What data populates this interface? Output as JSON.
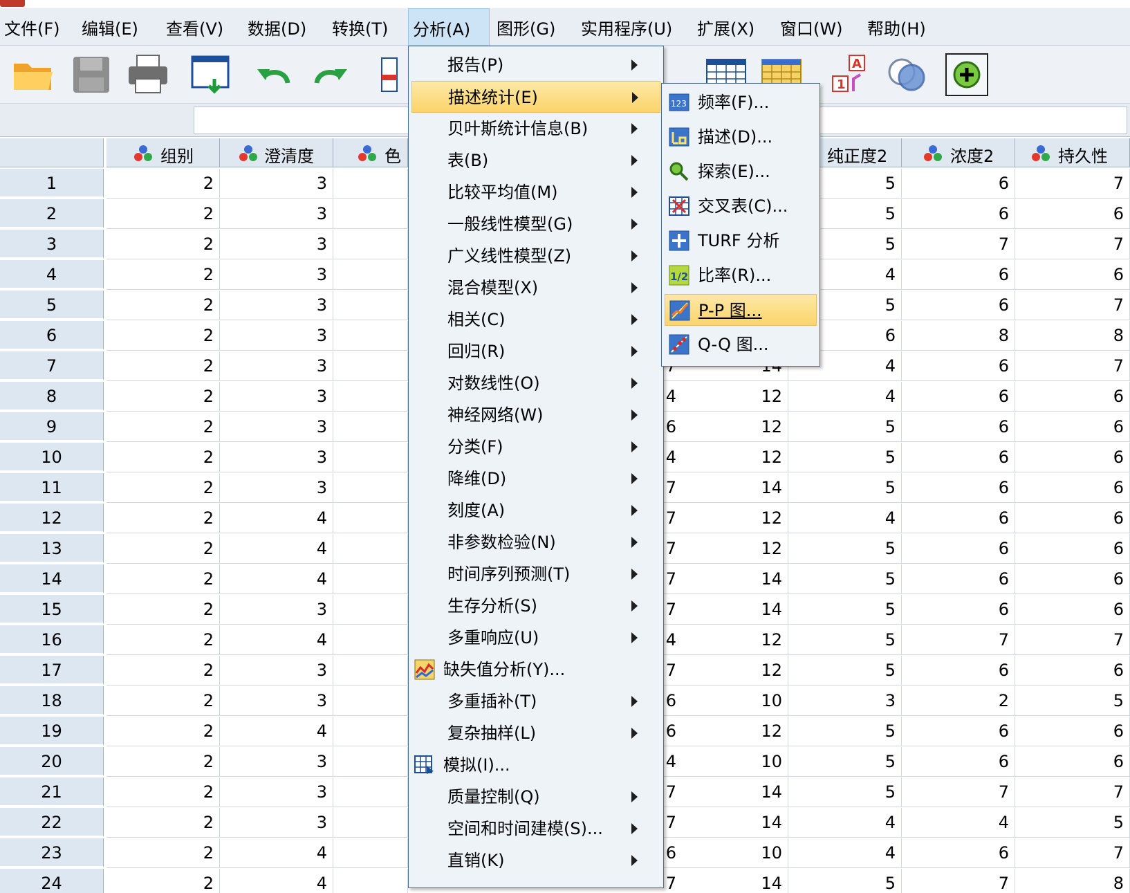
{
  "menubar": {
    "items": [
      {
        "label": "文件(F)"
      },
      {
        "label": "编辑(E)"
      },
      {
        "label": "查看(V)"
      },
      {
        "label": "数据(D)"
      },
      {
        "label": "转换(T)"
      },
      {
        "label": "分析(A)"
      },
      {
        "label": "图形(G)"
      },
      {
        "label": "实用程序(U)"
      },
      {
        "label": "扩展(X)"
      },
      {
        "label": "窗口(W)"
      },
      {
        "label": "帮助(H)"
      }
    ],
    "active_index": 5
  },
  "toolbar": {
    "buttons": [
      "open-folder-icon",
      "save-disk-icon",
      "printer-icon",
      "recall-dialog-icon",
      "undo-icon",
      "redo-icon",
      "goto-case-icon",
      "goto-variable-icon",
      "variables-grid-icon",
      "value-labels-icon",
      "split-file-icon",
      "weight-cases-icon",
      "add-on-icon"
    ]
  },
  "grid": {
    "headers": [
      "组别",
      "澄清度",
      "色",
      "纯正度2",
      "浓度2",
      "持久性"
    ],
    "rows": [
      {
        "n": "1",
        "c1": "2",
        "c2": "3",
        "c5": "",
        "c6": "",
        "c7": "5",
        "c8": "6",
        "c9": "7"
      },
      {
        "n": "2",
        "c1": "2",
        "c2": "3",
        "c5": "",
        "c6": "",
        "c7": "5",
        "c8": "6",
        "c9": "6"
      },
      {
        "n": "3",
        "c1": "2",
        "c2": "3",
        "c5": "",
        "c6": "",
        "c7": "5",
        "c8": "7",
        "c9": "7"
      },
      {
        "n": "4",
        "c1": "2",
        "c2": "3",
        "c5": "",
        "c6": "",
        "c7": "4",
        "c8": "6",
        "c9": "6"
      },
      {
        "n": "5",
        "c1": "2",
        "c2": "3",
        "c5": "",
        "c6": "",
        "c7": "5",
        "c8": "6",
        "c9": "7"
      },
      {
        "n": "6",
        "c1": "2",
        "c2": "3",
        "c5": "",
        "c6": "",
        "c7": "6",
        "c8": "8",
        "c9": "8"
      },
      {
        "n": "7",
        "c1": "2",
        "c2": "3",
        "c5": "7",
        "c6": "14",
        "c7": "4",
        "c8": "6",
        "c9": "7"
      },
      {
        "n": "8",
        "c1": "2",
        "c2": "3",
        "c5": "4",
        "c6": "12",
        "c7": "4",
        "c8": "6",
        "c9": "6"
      },
      {
        "n": "9",
        "c1": "2",
        "c2": "3",
        "c5": "6",
        "c6": "12",
        "c7": "5",
        "c8": "6",
        "c9": "6"
      },
      {
        "n": "10",
        "c1": "2",
        "c2": "3",
        "c5": "4",
        "c6": "12",
        "c7": "5",
        "c8": "6",
        "c9": "6"
      },
      {
        "n": "11",
        "c1": "2",
        "c2": "3",
        "c5": "7",
        "c6": "14",
        "c7": "5",
        "c8": "6",
        "c9": "6"
      },
      {
        "n": "12",
        "c1": "2",
        "c2": "4",
        "c5": "7",
        "c6": "12",
        "c7": "4",
        "c8": "6",
        "c9": "6"
      },
      {
        "n": "13",
        "c1": "2",
        "c2": "4",
        "c5": "7",
        "c6": "12",
        "c7": "5",
        "c8": "6",
        "c9": "6"
      },
      {
        "n": "14",
        "c1": "2",
        "c2": "4",
        "c5": "7",
        "c6": "14",
        "c7": "5",
        "c8": "6",
        "c9": "6"
      },
      {
        "n": "15",
        "c1": "2",
        "c2": "3",
        "c5": "7",
        "c6": "14",
        "c7": "5",
        "c8": "6",
        "c9": "6"
      },
      {
        "n": "16",
        "c1": "2",
        "c2": "4",
        "c5": "4",
        "c6": "12",
        "c7": "5",
        "c8": "7",
        "c9": "7"
      },
      {
        "n": "17",
        "c1": "2",
        "c2": "3",
        "c5": "7",
        "c6": "12",
        "c7": "5",
        "c8": "6",
        "c9": "6"
      },
      {
        "n": "18",
        "c1": "2",
        "c2": "3",
        "c5": "6",
        "c6": "10",
        "c7": "3",
        "c8": "2",
        "c9": "5"
      },
      {
        "n": "19",
        "c1": "2",
        "c2": "4",
        "c5": "6",
        "c6": "12",
        "c7": "5",
        "c8": "6",
        "c9": "6"
      },
      {
        "n": "20",
        "c1": "2",
        "c2": "3",
        "c5": "4",
        "c6": "10",
        "c7": "5",
        "c8": "6",
        "c9": "6"
      },
      {
        "n": "21",
        "c1": "2",
        "c2": "3",
        "c5": "7",
        "c6": "14",
        "c7": "5",
        "c8": "7",
        "c9": "7"
      },
      {
        "n": "22",
        "c1": "2",
        "c2": "3",
        "c5": "7",
        "c6": "14",
        "c7": "4",
        "c8": "4",
        "c9": "5"
      },
      {
        "n": "23",
        "c1": "2",
        "c2": "4",
        "c5": "6",
        "c6": "10",
        "c7": "4",
        "c8": "6",
        "c9": "7"
      },
      {
        "n": "24",
        "c1": "2",
        "c2": "4",
        "c5": "7",
        "c6": "14",
        "c7": "5",
        "c8": "7",
        "c9": "8"
      }
    ]
  },
  "analyze_menu": {
    "items": [
      {
        "label": "报告(P)",
        "submenu": true
      },
      {
        "label": "描述统计(E)",
        "submenu": true,
        "highlighted": true
      },
      {
        "label": "贝叶斯统计信息(B)",
        "submenu": true
      },
      {
        "label": "表(B)",
        "submenu": true
      },
      {
        "label": "比较平均值(M)",
        "submenu": true
      },
      {
        "label": "一般线性模型(G)",
        "submenu": true
      },
      {
        "label": "广义线性模型(Z)",
        "submenu": true
      },
      {
        "label": "混合模型(X)",
        "submenu": true
      },
      {
        "label": "相关(C)",
        "submenu": true
      },
      {
        "label": "回归(R)",
        "submenu": true
      },
      {
        "label": "对数线性(O)",
        "submenu": true
      },
      {
        "label": "神经网络(W)",
        "submenu": true
      },
      {
        "label": "分类(F)",
        "submenu": true
      },
      {
        "label": "降维(D)",
        "submenu": true
      },
      {
        "label": "刻度(A)",
        "submenu": true
      },
      {
        "label": "非参数检验(N)",
        "submenu": true
      },
      {
        "label": "时间序列预测(T)",
        "submenu": true
      },
      {
        "label": "生存分析(S)",
        "submenu": true
      },
      {
        "label": "多重响应(U)",
        "submenu": true
      },
      {
        "label": "缺失值分析(Y)...",
        "submenu": false,
        "icon": "missing-value-icon"
      },
      {
        "label": "多重插补(T)",
        "submenu": true
      },
      {
        "label": "复杂抽样(L)",
        "submenu": true
      },
      {
        "label": "模拟(I)...",
        "submenu": false,
        "icon": "simulation-icon"
      },
      {
        "label": "质量控制(Q)",
        "submenu": true
      },
      {
        "label": "空间和时间建模(S)...",
        "submenu": true
      },
      {
        "label": "直销(K)",
        "submenu": true
      }
    ]
  },
  "descriptive_submenu": {
    "items": [
      {
        "label": "频率(F)...",
        "icon": "frequencies-icon"
      },
      {
        "label": "描述(D)...",
        "icon": "descriptives-icon"
      },
      {
        "label": "探索(E)...",
        "icon": "explore-icon"
      },
      {
        "label": "交叉表(C)...",
        "icon": "crosstabs-icon"
      },
      {
        "label": "TURF 分析",
        "icon": "turf-icon"
      },
      {
        "label": "比率(R)...",
        "icon": "ratio-icon"
      },
      {
        "label": "P-P 图...",
        "icon": "pp-plot-icon",
        "highlighted": true
      },
      {
        "label": "Q-Q 图...",
        "icon": "qq-plot-icon"
      }
    ]
  },
  "colors": {
    "menu_bg": "#eef3f8",
    "highlight": "#fbd46a",
    "row_header": "#dde7f1",
    "header": "#dfe8f1"
  }
}
